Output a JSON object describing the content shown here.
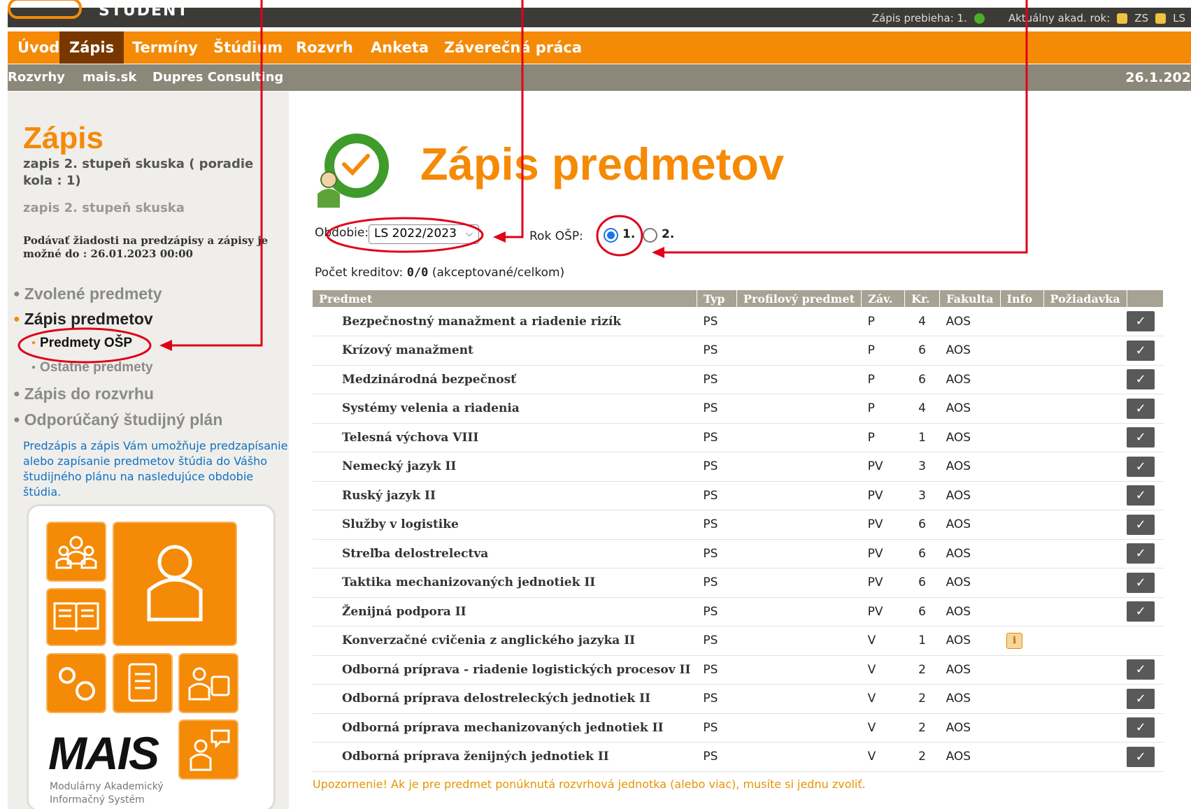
{
  "header": {
    "app_name": "STUDENT",
    "status_text": "Zápis prebieha: 1.",
    "academic_year_label": "Aktuálny akad. rok:",
    "semester_zs": "ZS",
    "semester_ls": "LS"
  },
  "menu": {
    "items": [
      "Úvod",
      "Zápis",
      "Termíny",
      "Štúdium",
      "Rozvrh",
      "Anketa",
      "Záverečná práca"
    ],
    "active": "Zápis"
  },
  "submenu": {
    "items": [
      "Rozvrhy",
      "mais.sk",
      "Dupres Consulting"
    ],
    "date": "26.1.202"
  },
  "sidebar": {
    "title": "Zápis",
    "subtitle": "zapis 2. stupeň skuska ( poradie kola : 1)",
    "subtitle2": "zapis 2. stupeň skuska",
    "deadline_note": "Podávať žiadosti na predzápisy a zápisy je možné do : 26.01.2023 00:00",
    "nav": [
      "Zvolené predmety",
      "Zápis predmetov",
      "Predmety OŠP",
      "Ostatné predmety",
      "Zápis do rozvrhu",
      "Odporúčaný študijný plán"
    ],
    "help_text": "Predzápis a zápis Vám umožňuje predzapísanie alebo zapísanie predmetov štúdia do Vášho študijného plánu na nasledujúce obdobie štúdia.",
    "logo_word": "MAIS",
    "logo_caption_1": "Modulárny Akademický",
    "logo_caption_2": "Informačný Systém"
  },
  "main": {
    "title": "Zápis predmetov",
    "period_label": "Obdobie:",
    "period_value": "LS 2022/2023",
    "rok_label": "Rok OŠP:",
    "rok_options": [
      "1.",
      "2."
    ],
    "rok_selected": "1.",
    "credits_label": "Počet kreditov:",
    "credits_value": "0/0",
    "credits_suffix": "(akceptované/celkom)",
    "warning": "Upozornenie! Ak je pre predmet ponúknutá rozvrhová jednotka (alebo viac), musíte si jednu zvoliť."
  },
  "table": {
    "columns": [
      "Predmet",
      "Typ",
      "Profilový predmet",
      "Záv.",
      "Kr.",
      "Fakulta",
      "Info",
      "Požiadavka"
    ],
    "rows": [
      {
        "name": "Bezpečnostný manažment a riadenie rizík",
        "typ": "PS",
        "zav": "P",
        "kr": "4",
        "fak": "AOS",
        "info": false,
        "req": true
      },
      {
        "name": "Krízový manažment",
        "typ": "PS",
        "zav": "P",
        "kr": "6",
        "fak": "AOS",
        "info": false,
        "req": true
      },
      {
        "name": "Medzinárodná bezpečnosť",
        "typ": "PS",
        "zav": "P",
        "kr": "6",
        "fak": "AOS",
        "info": false,
        "req": true
      },
      {
        "name": "Systémy velenia a riadenia",
        "typ": "PS",
        "zav": "P",
        "kr": "4",
        "fak": "AOS",
        "info": false,
        "req": true
      },
      {
        "name": "Telesná výchova VIII",
        "typ": "PS",
        "zav": "P",
        "kr": "1",
        "fak": "AOS",
        "info": false,
        "req": true
      },
      {
        "name": "Nemecký jazyk II",
        "typ": "PS",
        "zav": "PV",
        "kr": "3",
        "fak": "AOS",
        "info": false,
        "req": true
      },
      {
        "name": "Ruský jazyk II",
        "typ": "PS",
        "zav": "PV",
        "kr": "3",
        "fak": "AOS",
        "info": false,
        "req": true
      },
      {
        "name": "Služby v logistike",
        "typ": "PS",
        "zav": "PV",
        "kr": "6",
        "fak": "AOS",
        "info": false,
        "req": true
      },
      {
        "name": "Streľba delostrelectva",
        "typ": "PS",
        "zav": "PV",
        "kr": "6",
        "fak": "AOS",
        "info": false,
        "req": true
      },
      {
        "name": "Taktika mechanizovaných jednotiek II",
        "typ": "PS",
        "zav": "PV",
        "kr": "6",
        "fak": "AOS",
        "info": false,
        "req": true
      },
      {
        "name": "Ženijná podpora II",
        "typ": "PS",
        "zav": "PV",
        "kr": "6",
        "fak": "AOS",
        "info": false,
        "req": true
      },
      {
        "name": "Konverzačné cvičenia z anglického jazyka II",
        "typ": "PS",
        "zav": "V",
        "kr": "1",
        "fak": "AOS",
        "info": true,
        "req": false
      },
      {
        "name": "Odborná príprava - riadenie logistických procesov II",
        "typ": "PS",
        "zav": "V",
        "kr": "2",
        "fak": "AOS",
        "info": false,
        "req": true
      },
      {
        "name": "Odborná príprava delostreleckých jednotiek II",
        "typ": "PS",
        "zav": "V",
        "kr": "2",
        "fak": "AOS",
        "info": false,
        "req": true
      },
      {
        "name": "Odborná príprava mechanizovaných jednotiek II",
        "typ": "PS",
        "zav": "V",
        "kr": "2",
        "fak": "AOS",
        "info": false,
        "req": true
      },
      {
        "name": "Odborná príprava ženijných jednotiek II",
        "typ": "PS",
        "zav": "V",
        "kr": "2",
        "fak": "AOS",
        "info": false,
        "req": true
      }
    ]
  },
  "colors": {
    "orange": "#f58a07",
    "menu_active": "#793700",
    "annotation_red": "#e0001a",
    "radio_blue": "#1a73e8"
  },
  "icons": {
    "check": "check-icon",
    "info": "info-icon",
    "status": "refresh-icon"
  }
}
